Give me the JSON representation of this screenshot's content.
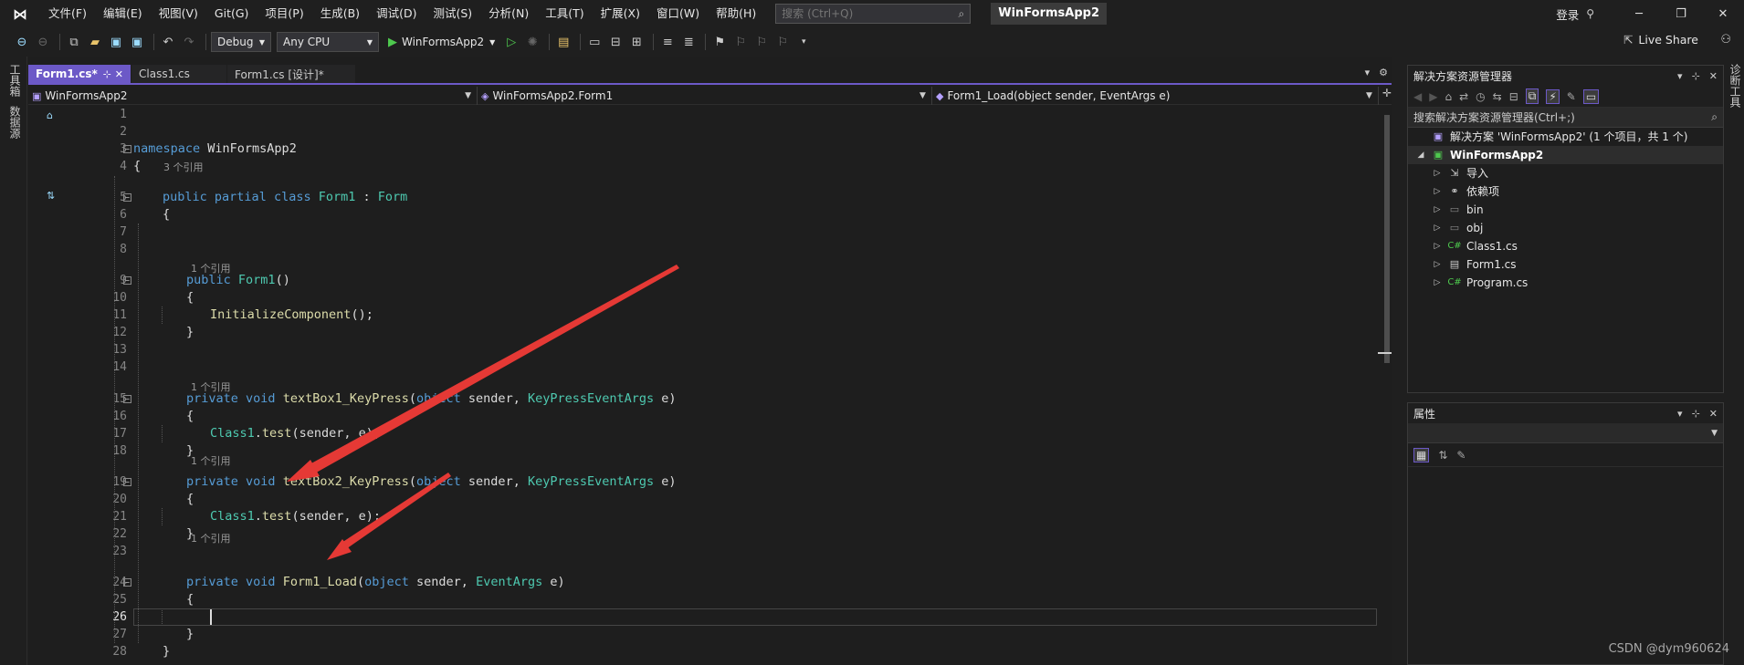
{
  "title_bar": {
    "menu": [
      "文件(F)",
      "编辑(E)",
      "视图(V)",
      "Git(G)",
      "项目(P)",
      "生成(B)",
      "调试(D)",
      "测试(S)",
      "分析(N)",
      "工具(T)",
      "扩展(X)",
      "窗口(W)",
      "帮助(H)"
    ],
    "search_placeholder": "搜索 (Ctrl+Q)",
    "app_name": "WinFormsApp2",
    "login_label": "登录"
  },
  "toolbar": {
    "config": "Debug",
    "platform": "Any CPU",
    "run_target": "WinFormsApp2",
    "live_share": "Live Share"
  },
  "left_strip": {
    "toolbox": "工具箱",
    "datasource": "数据源"
  },
  "right_strip": {
    "diagnostics": "诊断工具"
  },
  "editor": {
    "tabs": [
      "Form1.cs*",
      "Class1.cs",
      "Form1.cs [设计]*"
    ],
    "nav": {
      "project": "WinFormsApp2",
      "class": "WinFormsApp2.Form1",
      "member": "Form1_Load(object sender, EventArgs e)"
    },
    "current_line": 26,
    "lines": [
      {
        "n": 1,
        "t": ""
      },
      {
        "n": 2,
        "t": ""
      },
      {
        "n": 3,
        "t": "namespace WinFormsApp2"
      },
      {
        "n": 4,
        "t": "{"
      },
      {
        "n": 5,
        "t": "public partial class Form1 : Form"
      },
      {
        "n": 6,
        "t": "{"
      },
      {
        "n": 7,
        "t": ""
      },
      {
        "n": 8,
        "t": ""
      },
      {
        "n": 9,
        "t": "public Form1()"
      },
      {
        "n": 10,
        "t": "{"
      },
      {
        "n": 11,
        "t": "InitializeComponent();"
      },
      {
        "n": 12,
        "t": "}"
      },
      {
        "n": 13,
        "t": ""
      },
      {
        "n": 14,
        "t": ""
      },
      {
        "n": 15,
        "t": "private void textBox1_KeyPress(object sender, KeyPressEventArgs e)"
      },
      {
        "n": 16,
        "t": "{"
      },
      {
        "n": 17,
        "t": "Class1.test(sender, e);"
      },
      {
        "n": 18,
        "t": "}"
      },
      {
        "n": 19,
        "t": "private void textBox2_KeyPress(object sender, KeyPressEventArgs e)"
      },
      {
        "n": 20,
        "t": "{"
      },
      {
        "n": 21,
        "t": "Class1.test(sender, e);"
      },
      {
        "n": 22,
        "t": "}"
      },
      {
        "n": 23,
        "t": ""
      },
      {
        "n": 24,
        "t": "private void Form1_Load(object sender, EventArgs e)"
      },
      {
        "n": 25,
        "t": "{"
      },
      {
        "n": 26,
        "t": ""
      },
      {
        "n": 27,
        "t": "}"
      },
      {
        "n": 28,
        "t": "}"
      }
    ],
    "codelens": {
      "class": "3 个引用",
      "ctor": "1 个引用",
      "kp1": "1 个引用",
      "kp2": "1 个引用",
      "load": "1 个引用"
    }
  },
  "solution_explorer": {
    "title": "解决方案资源管理器",
    "search_placeholder": "搜索解决方案资源管理器(Ctrl+;)",
    "items": [
      {
        "label": "解决方案 'WinFormsApp2' (1 个项目，共 1 个)",
        "icon": "solution-icon"
      },
      {
        "label": "WinFormsApp2",
        "icon": "csharp-project-icon"
      },
      {
        "label": "导入",
        "icon": "import-icon"
      },
      {
        "label": "依赖项",
        "icon": "dependencies-icon"
      },
      {
        "label": "bin",
        "icon": "folder-icon"
      },
      {
        "label": "obj",
        "icon": "folder-icon"
      },
      {
        "label": "Class1.cs",
        "icon": "csharp-file-icon"
      },
      {
        "label": "Form1.cs",
        "icon": "form-file-icon"
      },
      {
        "label": "Program.cs",
        "icon": "csharp-file-icon"
      }
    ]
  },
  "properties": {
    "title": "属性"
  },
  "watermark": "CSDN @dym960624",
  "colors": {
    "accent": "#6c59c7",
    "keyword": "#569cd6",
    "type": "#4ec9b0",
    "method": "#dcdcaa",
    "arrow": "#e53935"
  }
}
